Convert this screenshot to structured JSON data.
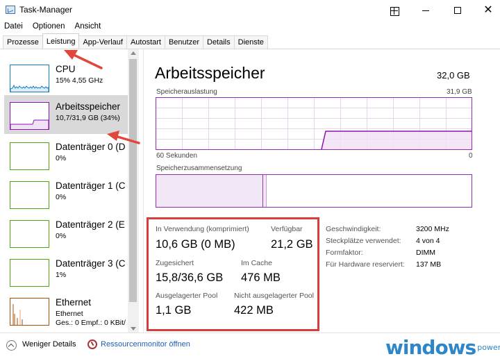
{
  "window": {
    "title": "Task-Manager"
  },
  "menu": [
    "Datei",
    "Optionen",
    "Ansicht"
  ],
  "tabs": [
    {
      "label": "Prozesse",
      "active": false
    },
    {
      "label": "Leistung",
      "active": true
    },
    {
      "label": "App-Verlauf",
      "active": false
    },
    {
      "label": "Autostart",
      "active": false
    },
    {
      "label": "Benutzer",
      "active": false
    },
    {
      "label": "Details",
      "active": false
    },
    {
      "label": "Dienste",
      "active": false
    }
  ],
  "sidebar": {
    "items": [
      {
        "title": "CPU",
        "sub": "15%  4,55 GHz",
        "sub2": "",
        "color": "#117dbb"
      },
      {
        "title": "Arbeitsspeicher",
        "sub": "10,7/31,9 GB (34%)",
        "sub2": "",
        "color": "#8b12ae"
      },
      {
        "title": "Datenträger 0 (D",
        "sub": "0%",
        "sub2": "",
        "color": "#4da60c"
      },
      {
        "title": "Datenträger 1 (C",
        "sub": "0%",
        "sub2": "",
        "color": "#4da60c"
      },
      {
        "title": "Datenträger 2 (E",
        "sub": "0%",
        "sub2": "",
        "color": "#4da60c"
      },
      {
        "title": "Datenträger 3 (C",
        "sub": "1%",
        "sub2": "",
        "color": "#4da60c"
      },
      {
        "title": "Ethernet",
        "sub": "Ethernet",
        "sub2": "Ges.: 0  Empf.: 0 KBit/",
        "color": "#a74f01"
      }
    ]
  },
  "main": {
    "title": "Arbeitsspeicher",
    "total": "32,0 GB",
    "usage_label": "Speicherauslastung",
    "usage_max": "31,9 GB",
    "time_left": "60 Sekunden",
    "time_right": "0",
    "composition_label": "Speicherzusammensetzung",
    "accent_color": "#9528b4",
    "composition_used_fraction": 0.34
  },
  "stats": {
    "in_use_label": "In Verwendung (komprimiert)",
    "in_use_value": "10,6 GB (0 MB)",
    "available_label": "Verfügbar",
    "available_value": "21,2 GB",
    "committed_label": "Zugesichert",
    "committed_value": "15,8/36,6 GB",
    "cached_label": "Im Cache",
    "cached_value": "476 MB",
    "paged_label": "Ausgelagerter Pool",
    "paged_value": "1,1 GB",
    "nonpaged_label": "Nicht ausgelagerter Pool",
    "nonpaged_value": "422 MB"
  },
  "info": [
    {
      "label": "Geschwindigkeit:",
      "value": "3200 MHz"
    },
    {
      "label": "Steckplätze verwendet:",
      "value": "4 von 4"
    },
    {
      "label": "Formfaktor:",
      "value": "DIMM"
    },
    {
      "label": "Für Hardware reserviert:",
      "value": "137 MB"
    }
  ],
  "footer": {
    "fewer_details": "Weniger Details",
    "resource_monitor": "Ressourcenmonitor öffnen"
  },
  "logo": {
    "main": "windows",
    "sub": "power"
  }
}
